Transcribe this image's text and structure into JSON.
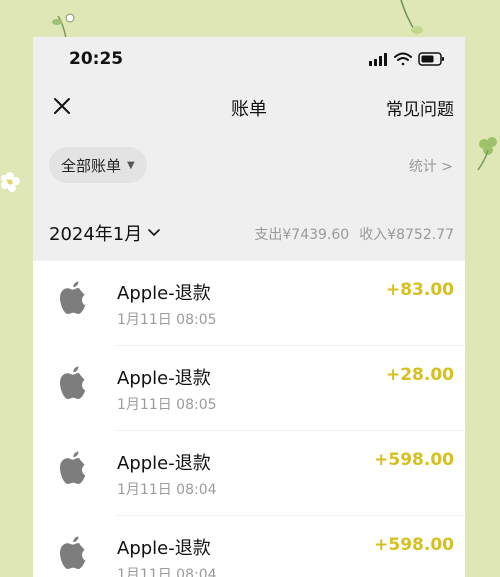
{
  "status": {
    "time": "20:25"
  },
  "header": {
    "title": "账单",
    "faq_label": "常见问题"
  },
  "filter": {
    "label": "全部账单",
    "stats_label": "统计 >"
  },
  "month": {
    "label": "2024年1月",
    "expense": "支出¥7439.60",
    "income": "收入¥8752.77"
  },
  "transactions": [
    {
      "name": "Apple-退款",
      "time": "1月11日 08:05",
      "amount": "+83.00",
      "icon": "apple-icon"
    },
    {
      "name": "Apple-退款",
      "time": "1月11日 08:05",
      "amount": "+28.00",
      "icon": "apple-icon"
    },
    {
      "name": "Apple-退款",
      "time": "1月11日 08:04",
      "amount": "+598.00",
      "icon": "apple-icon"
    },
    {
      "name": "Apple-退款",
      "time": "1月11日 08:04",
      "amount": "+598.00",
      "icon": "apple-icon"
    }
  ],
  "colors": {
    "background": "#dfe7b6",
    "panel": "#efefef",
    "income_amount": "#d7bf1f"
  }
}
